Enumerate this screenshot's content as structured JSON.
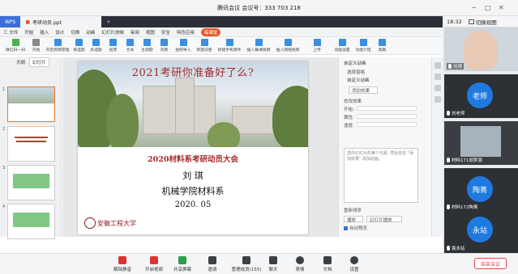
{
  "meeting": {
    "title": "腾讯会议 会议号：333 703 218",
    "time": "18:32",
    "share_switch": "切换视图"
  },
  "wps": {
    "home_tab": "WPS",
    "doc_tab": "考研动员.ppt",
    "menu_file": "三 文件",
    "menu": [
      "开始",
      "插入",
      "设计",
      "切换",
      "动画",
      "幻灯片放映",
      "审阅",
      "视图",
      "安全",
      "特色应用"
    ],
    "menu_active": "开始",
    "menu_highlight": "每课堂",
    "tools": [
      "微信扫一扫",
      "开始",
      "开启高频管理",
      "单选题",
      "多选题",
      "投票",
      "文本",
      "主观题",
      "问卷",
      "拍照导入",
      "新建试卷",
      "新建手机课件",
      "插入幕课视频",
      "插入网络视频",
      "上传",
      "功能设置",
      "功能介绍",
      "帮助"
    ],
    "left_tabs": [
      "大纲",
      "幻灯片"
    ],
    "thumb_nums": [
      "1",
      "2",
      "3",
      "4"
    ],
    "slide": {
      "headline": "2021考研你准备好了么?",
      "subtitle": "2020材料系考研动员大会",
      "name": "刘  琪",
      "dept": "机械学院材料系",
      "date": "2020. 05",
      "logo_text": "安徽工程大学"
    },
    "pane": {
      "title": "自定义动画",
      "select": "选择窗格",
      "custom": "自定义动画",
      "add": "添加效果",
      "modify": "修改效果",
      "start_lbl": "开始:",
      "prop_lbl": "属性:",
      "speed_lbl": "速度:",
      "hint": "选中幻灯片的某个元素, 然后单击 \"添加效果\" 添加动画。",
      "reorder": "重新排序",
      "play": "播放",
      "show": "幻灯片播放",
      "autopreview": "自动预览"
    }
  },
  "participants": [
    {
      "name": "刘琪",
      "avatar": "",
      "color": "#6b5b4f"
    },
    {
      "name": "刘老师",
      "avatar": "老师",
      "color": "#1f7ae0"
    },
    {
      "name": "材料171胡梦源",
      "avatar": "",
      "color": "#8a9ba8"
    },
    {
      "name": "材料172陶菁",
      "avatar": "陶菁",
      "color": "#1f7ae0"
    },
    {
      "name": "袁永站",
      "avatar": "永站",
      "color": "#1f7ae0"
    }
  ],
  "toolbar": {
    "mute": "解除静音",
    "video": "开启视频",
    "share": "共享屏幕",
    "invite": "邀请",
    "members": "管理成员(155)",
    "chat": "聊天",
    "reactions": "表情",
    "docs": "文档",
    "settings": "设置",
    "end": "结束会议"
  }
}
